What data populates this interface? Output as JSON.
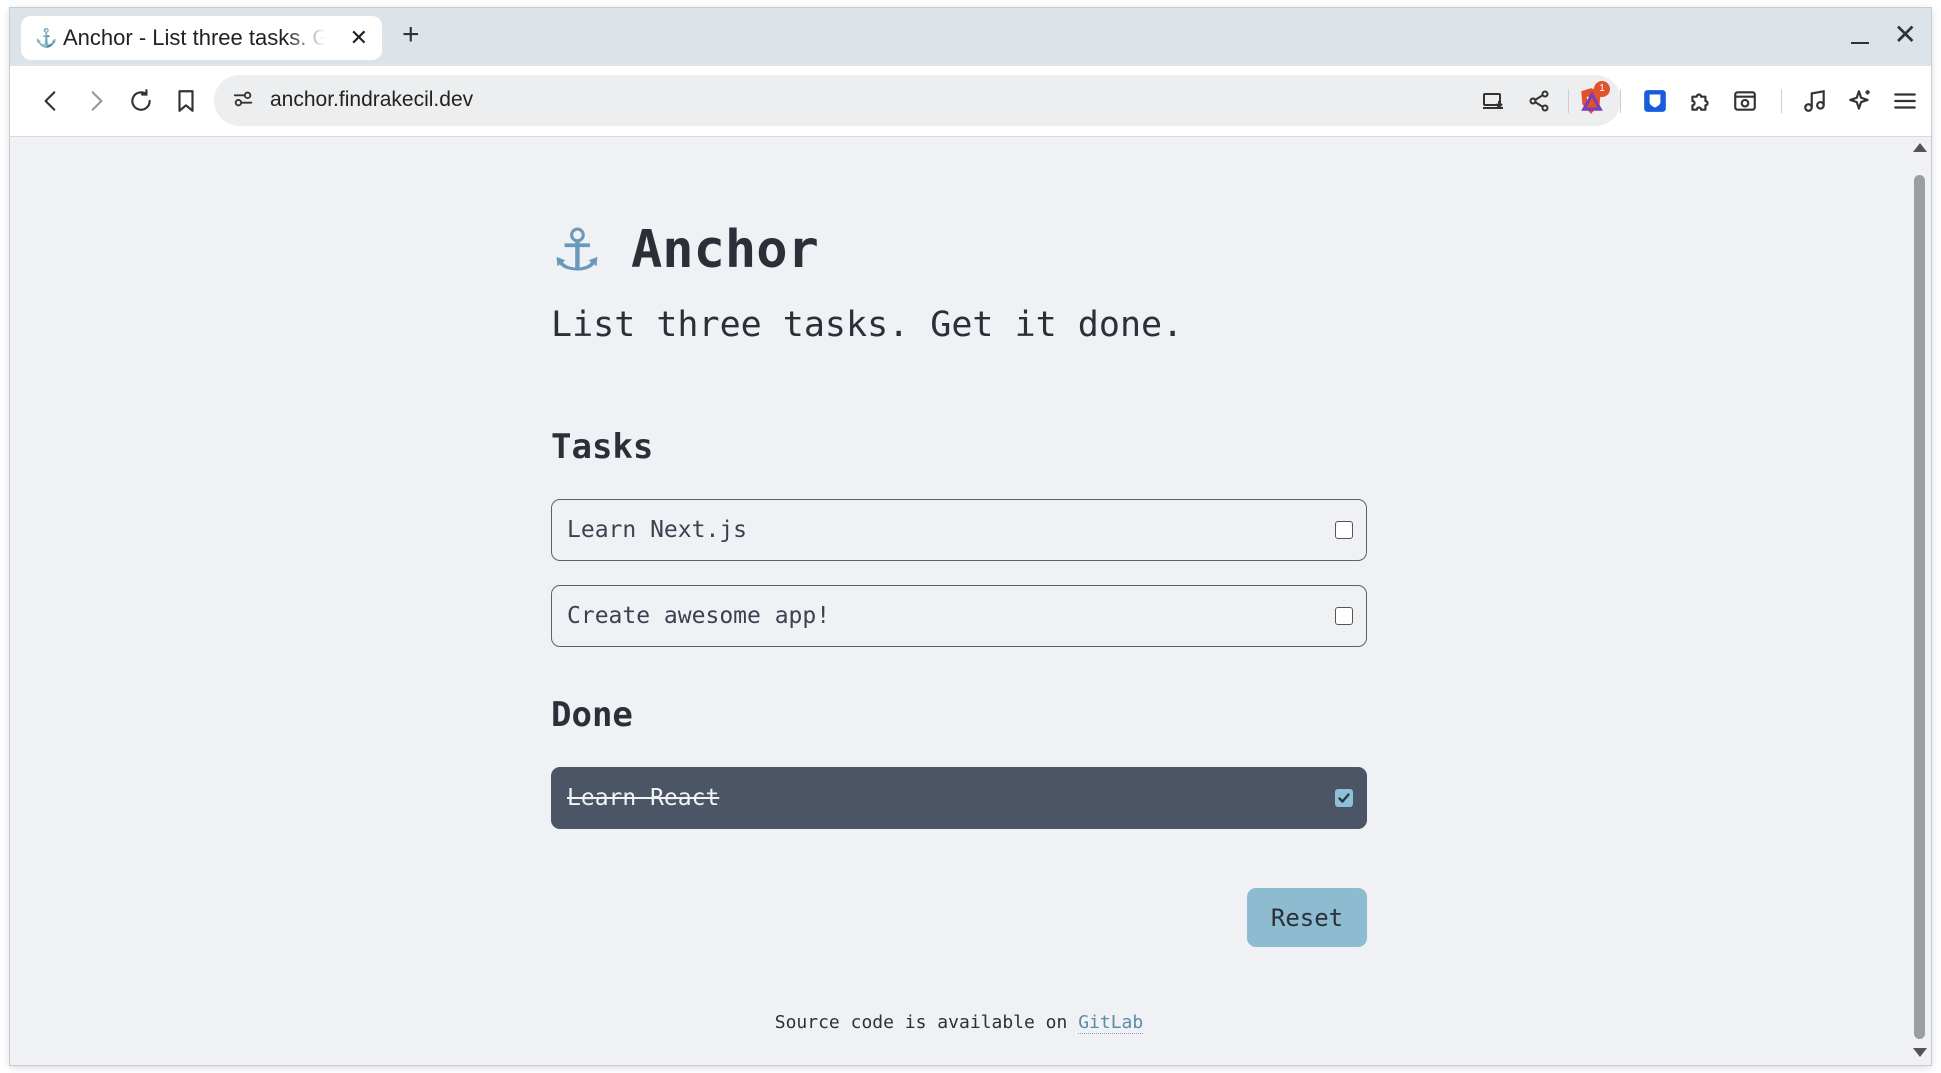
{
  "browser": {
    "tab_title": "Anchor - List three tasks. Get it done.",
    "tab_favicon": "⚓",
    "new_tab_glyph": "+",
    "url": "anchor.findrakecil.dev",
    "notification_count": "1"
  },
  "app": {
    "icon": "⚓",
    "title": "Anchor",
    "tagline": "List three tasks. Get it done."
  },
  "tasks_section": {
    "heading": "Tasks",
    "items": [
      {
        "text": "Learn Next.js",
        "checked": false
      },
      {
        "text": "Create awesome app!",
        "checked": false
      }
    ]
  },
  "done_section": {
    "heading": "Done",
    "items": [
      {
        "text": "Learn React",
        "checked": true
      }
    ]
  },
  "reset_label": "Reset",
  "footer": {
    "text": "Source code is available on",
    "link_label": "GitLab"
  },
  "colors": {
    "page_bg": "#eff1f5",
    "done_bg": "#4c5566",
    "accent": "#8dbcd0"
  }
}
